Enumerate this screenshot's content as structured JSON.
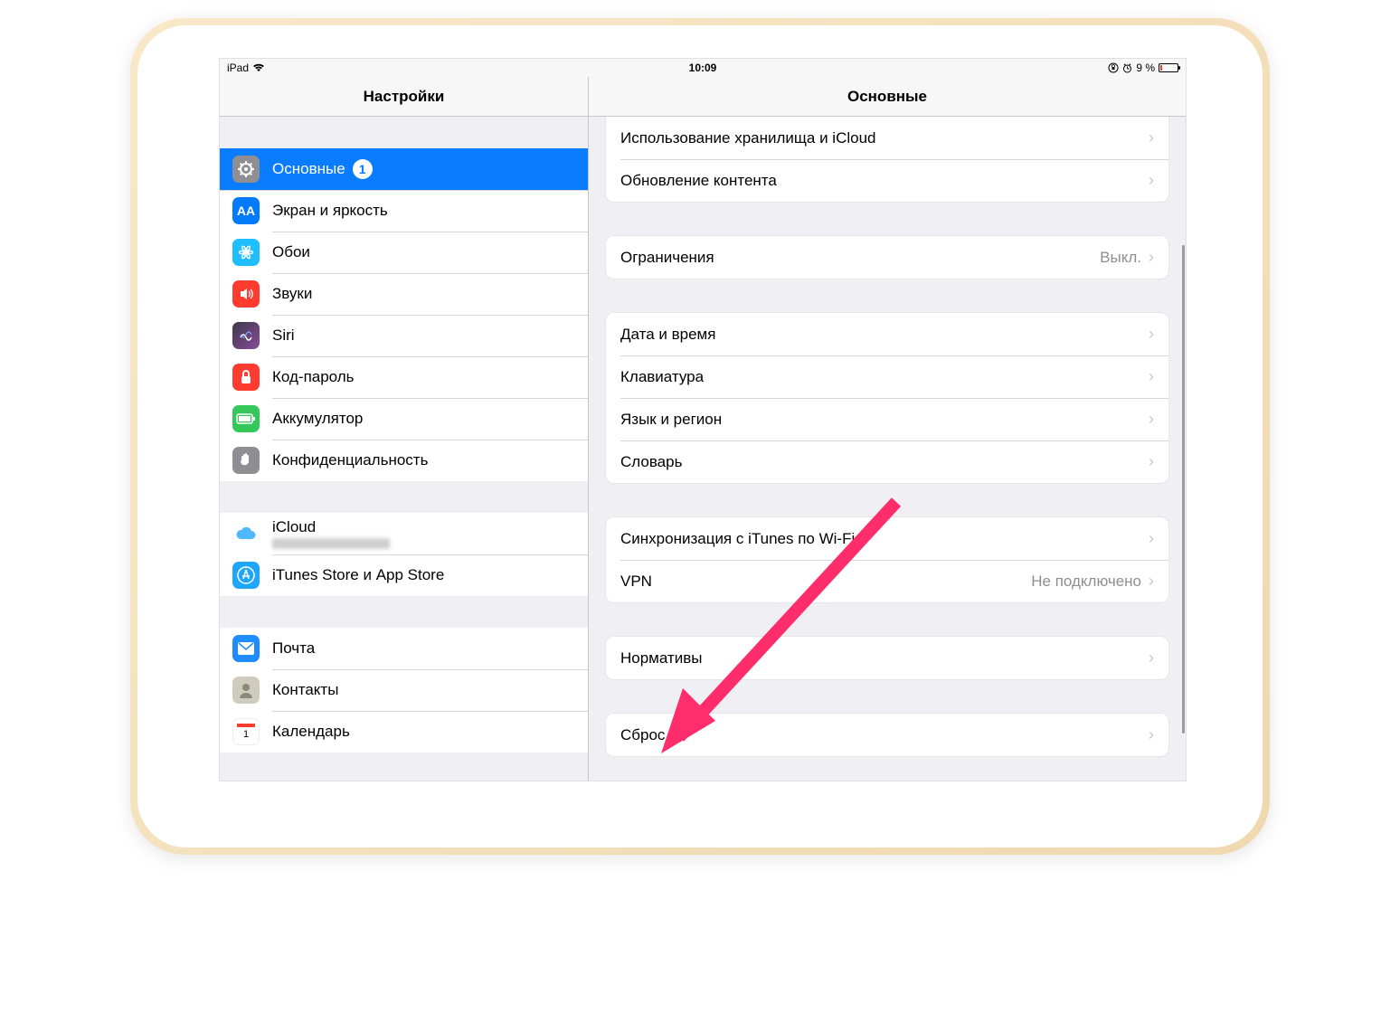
{
  "statusbar": {
    "device": "iPad",
    "time": "10:09",
    "battery_percent": "9 %",
    "battery_level": 9
  },
  "left": {
    "title": "Настройки",
    "groups": [
      [
        {
          "id": "general",
          "icon": "gear",
          "label": "Основные",
          "selected": true,
          "badge": "1"
        },
        {
          "id": "display",
          "icon": "aa",
          "label": "Экран и яркость"
        },
        {
          "id": "wallpaper",
          "icon": "flower",
          "label": "Обои"
        },
        {
          "id": "sounds",
          "icon": "speaker",
          "label": "Звуки"
        },
        {
          "id": "siri",
          "icon": "siri",
          "label": "Siri"
        },
        {
          "id": "passcode",
          "icon": "lock",
          "label": "Код-пароль"
        },
        {
          "id": "battery",
          "icon": "battery",
          "label": "Аккумулятор"
        },
        {
          "id": "privacy",
          "icon": "hand",
          "label": "Конфиденциальность"
        }
      ],
      [
        {
          "id": "icloud",
          "icon": "cloud",
          "label": "iCloud",
          "sub_blur": true
        },
        {
          "id": "appstore",
          "icon": "appstore",
          "label": "iTunes Store и App Store"
        }
      ],
      [
        {
          "id": "mail",
          "icon": "mail",
          "label": "Почта"
        },
        {
          "id": "contacts",
          "icon": "contacts",
          "label": "Контакты"
        },
        {
          "id": "calendar",
          "icon": "calendar",
          "label": "Календарь"
        }
      ]
    ]
  },
  "right": {
    "title": "Основные",
    "groups": [
      [
        {
          "id": "storage",
          "label": "Использование хранилища и iCloud"
        },
        {
          "id": "refresh",
          "label": "Обновление контента"
        }
      ],
      [
        {
          "id": "restrictions",
          "label": "Ограничения",
          "value": "Выкл."
        }
      ],
      [
        {
          "id": "datetime",
          "label": "Дата и время"
        },
        {
          "id": "keyboard",
          "label": "Клавиатура"
        },
        {
          "id": "language",
          "label": "Язык и регион"
        },
        {
          "id": "dictionary",
          "label": "Словарь"
        }
      ],
      [
        {
          "id": "itunessync",
          "label": "Синхронизация с iTunes по Wi-Fi"
        },
        {
          "id": "vpn",
          "label": "VPN",
          "value": "Не подключено"
        }
      ],
      [
        {
          "id": "regulatory",
          "label": "Нормативы"
        }
      ],
      [
        {
          "id": "reset",
          "label": "Сброс"
        }
      ]
    ]
  }
}
